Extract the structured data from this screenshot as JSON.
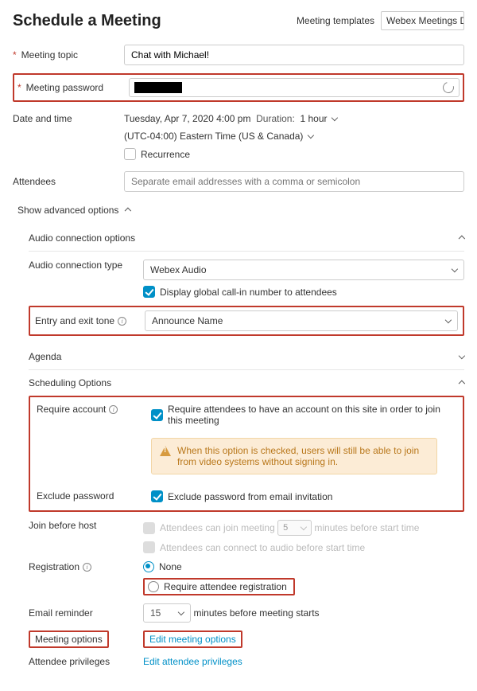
{
  "header": {
    "title": "Schedule a Meeting",
    "templates_link": "Meeting templates",
    "template_dropdown": "Webex Meetings Defau"
  },
  "topic": {
    "label": "Meeting topic",
    "value": "Chat with Michael!"
  },
  "password": {
    "label": "Meeting password"
  },
  "datetime": {
    "label": "Date and time",
    "value": "Tuesday, Apr 7, 2020 4:00 pm",
    "duration_label": "Duration:",
    "duration": "1 hour",
    "timezone": "(UTC-04:00) Eastern Time (US & Canada)",
    "recurrence": "Recurrence"
  },
  "attendees": {
    "label": "Attendees",
    "placeholder": "Separate email addresses with a comma or semicolon"
  },
  "advanced_toggle": "Show advanced options",
  "audio": {
    "title": "Audio connection options",
    "type_label": "Audio connection type",
    "type_value": "Webex Audio",
    "global_number": "Display global call-in number to attendees",
    "tone_label": "Entry and exit tone",
    "tone_value": "Announce Name"
  },
  "agenda": {
    "title": "Agenda"
  },
  "sched": {
    "title": "Scheduling Options",
    "require_account_label": "Require account",
    "require_account_text": "Require attendees to have an account on this site in order to join this meeting",
    "alert_text": "When this option is checked, users will still be able to join from video systems without signing in.",
    "exclude_pw_label": "Exclude password",
    "exclude_pw_text": "Exclude password from email invitation",
    "jbh_label": "Join before host",
    "jbh_line1a": "Attendees can join meeting",
    "jbh_minutes": "5",
    "jbh_line1b": "minutes before start time",
    "jbh_line2": "Attendees can connect to audio before start time",
    "reg_label": "Registration",
    "reg_none": "None",
    "reg_require": "Require attendee registration",
    "reminder_label": "Email reminder",
    "reminder_value": "15",
    "reminder_suffix": "minutes before meeting starts",
    "options_label": "Meeting options",
    "options_link": "Edit meeting options",
    "priv_label": "Attendee privileges",
    "priv_link": "Edit attendee privileges"
  }
}
